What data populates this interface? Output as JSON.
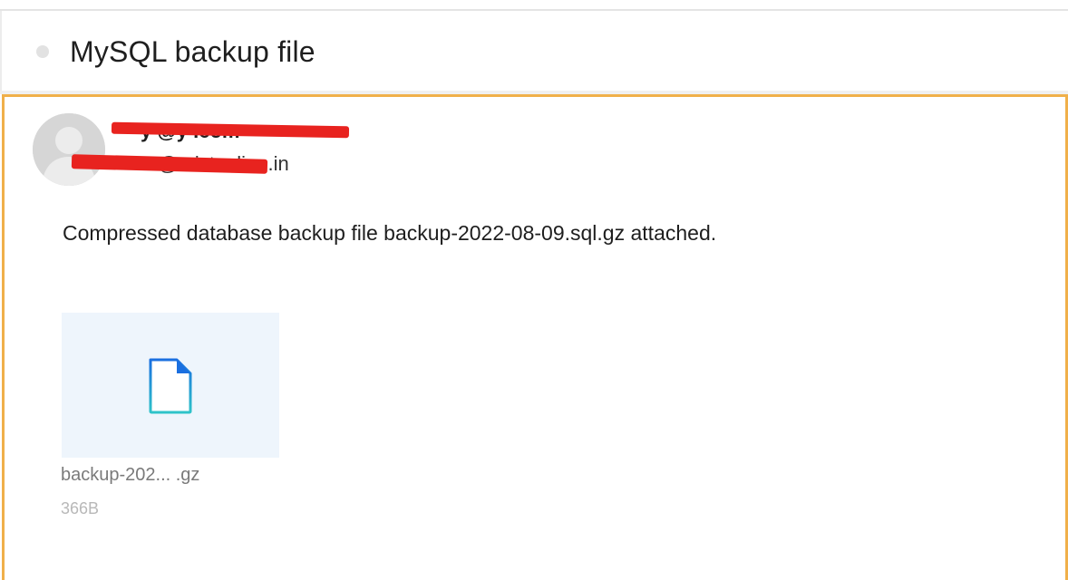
{
  "subject": {
    "title": "MySQL backup file"
  },
  "message": {
    "sender_email": "y     @y          .com",
    "recipient_line": "T          @mistonline.in",
    "body": "Compressed database backup file backup-2022-08-09.sql.gz attached."
  },
  "attachment": {
    "name": "backup-202...  .gz",
    "size": "366B",
    "icon": "file-icon"
  },
  "colors": {
    "accent_border": "#f0b04a",
    "redaction": "#e8231f",
    "attachment_bg": "#eef5fc",
    "file_icon_blue": "#1a6fe0",
    "file_icon_teal": "#2ec3c9"
  }
}
